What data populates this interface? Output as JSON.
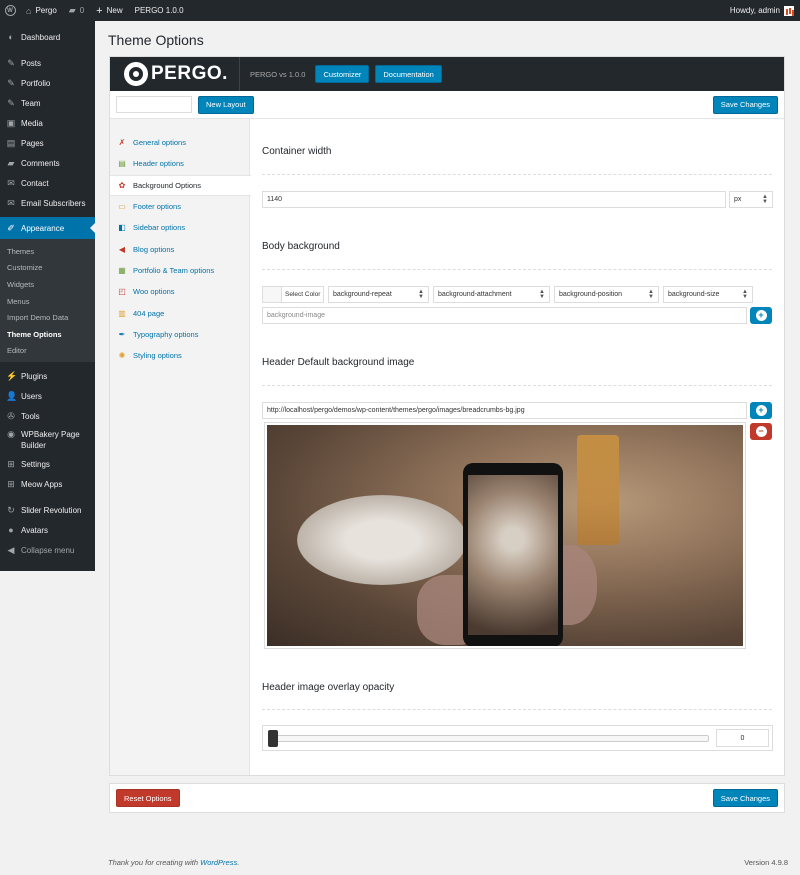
{
  "adminbar": {
    "site_name": "Pergo",
    "comments_count": "0",
    "new_label": "New",
    "theme_label": "PERGO 1.0.0",
    "howdy": "Howdy, admin"
  },
  "menu": {
    "items_top": [
      {
        "label": "Dashboard",
        "icon": "dashboard-icon"
      },
      {
        "label": "Posts",
        "icon": "pin-icon"
      },
      {
        "label": "Portfolio",
        "icon": "pin-icon"
      },
      {
        "label": "Team",
        "icon": "pin-icon"
      },
      {
        "label": "Media",
        "icon": "media-icon"
      },
      {
        "label": "Pages",
        "icon": "pages-icon"
      },
      {
        "label": "Comments",
        "icon": "comment-icon"
      },
      {
        "label": "Contact",
        "icon": "mail-icon"
      },
      {
        "label": "Email Subscribers",
        "icon": "mail-icon"
      }
    ],
    "current": "Appearance",
    "submenu": [
      "Themes",
      "Customize",
      "Widgets",
      "Menus",
      "Import Demo Data",
      "Theme Options",
      "Editor"
    ],
    "items_bottom": [
      "Plugins",
      "Users",
      "Tools",
      "WPBakery Page Builder",
      "Settings",
      "Meow Apps"
    ],
    "items_extra": [
      "Slider Revolution",
      "Avatars",
      "Collapse menu"
    ]
  },
  "page": {
    "title": "Theme Options"
  },
  "panel": {
    "logo_text": "PERGO.",
    "version": "PERGO vs 1.0.0",
    "customizer_label": "Customizer",
    "documentation_label": "Documentation",
    "new_layout_label": "New Layout",
    "save_label": "Save Changes",
    "reset_label": "Reset Options"
  },
  "nav": [
    {
      "label": "General options",
      "icon": "wrench-icon"
    },
    {
      "label": "Header options",
      "icon": "header-icon"
    },
    {
      "label": "Background Options",
      "icon": "background-icon"
    },
    {
      "label": "Footer options",
      "icon": "footer-icon"
    },
    {
      "label": "Sidebar options",
      "icon": "sidebar-icon"
    },
    {
      "label": "Blog options",
      "icon": "megaphone-icon"
    },
    {
      "label": "Portfolio & Team options",
      "icon": "portfolio-icon"
    },
    {
      "label": "Woo options",
      "icon": "woo-icon"
    },
    {
      "label": "404 page",
      "icon": "error-page-icon"
    },
    {
      "label": "Typography options",
      "icon": "typography-icon"
    },
    {
      "label": "Styling options",
      "icon": "palette-icon"
    }
  ],
  "nav_active": 2,
  "content": {
    "container_width": {
      "title": "Container width",
      "value": "1140",
      "unit": "px"
    },
    "body_background": {
      "title": "Body background",
      "select_color": "Select Color",
      "repeat": "background-repeat",
      "attachment": "background-attachment",
      "position": "background-position",
      "size": "background-size",
      "image_placeholder": "background-image"
    },
    "header_bg": {
      "title": "Header Default background image",
      "url": "http://localhost/pergo/demos/wp-content/themes/pergo/images/breadcrumbs-bg.jpg"
    },
    "overlay": {
      "title": "Header image overlay opacity",
      "value": "0",
      "level": 0
    }
  },
  "footer": {
    "thanks_prefix": "Thank you for creating with ",
    "thanks_link": "WordPress",
    "thanks_suffix": ".",
    "version": "Version 4.9.8"
  },
  "colors": {
    "accent": "#0073aa",
    "button": "#0085ba",
    "danger": "#c0392b",
    "adminbar": "#23282d"
  }
}
